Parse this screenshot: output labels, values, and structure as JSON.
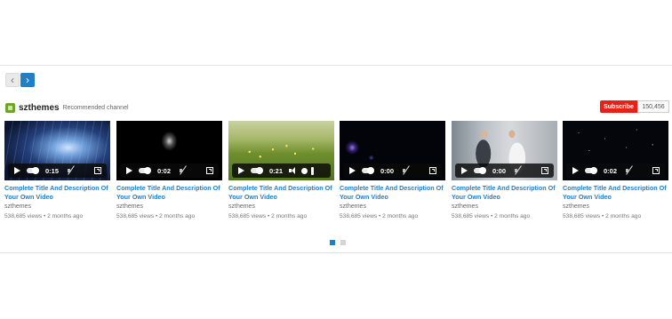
{
  "nav": {
    "prev_icon": "chevron-left-icon",
    "next_icon": "chevron-right-icon"
  },
  "channel": {
    "name": "szthemes",
    "tag": "Recommended channel",
    "logo_icon": "channel-logo-icon",
    "subscribe_label": "Subscribe",
    "subscriber_count": "150,456"
  },
  "videos": [
    {
      "title": "Complete Title And Description Of Your Own Video",
      "channel": "szthemes",
      "views": "538,685 views",
      "age": "2 months ago",
      "time": "0:15"
    },
    {
      "title": "Complete Title And Description Of Your Own Video",
      "channel": "szthemes",
      "views": "538,685 views",
      "age": "2 months ago",
      "time": "0:02"
    },
    {
      "title": "Complete Title And Description Of Your Own Video",
      "channel": "szthemes",
      "views": "538,685 views",
      "age": "2 months ago",
      "time": "0:21"
    },
    {
      "title": "Complete Title And Description Of Your Own Video",
      "channel": "szthemes",
      "views": "538,685 views",
      "age": "2 months ago",
      "time": "0:00"
    },
    {
      "title": "Complete Title And Description Of Your Own Video",
      "channel": "szthemes",
      "views": "538,685 views",
      "age": "2 months ago",
      "time": "0:00"
    },
    {
      "title": "Complete Title And Description Of Your Own Video",
      "channel": "szthemes",
      "views": "538,685 views",
      "age": "2 months ago",
      "time": "0:02"
    }
  ],
  "meta_separator": "•",
  "pager": {
    "pages": 2,
    "current": 1
  },
  "colors": {
    "accent": "#1f7fc9",
    "subscribe": "#e62117"
  }
}
